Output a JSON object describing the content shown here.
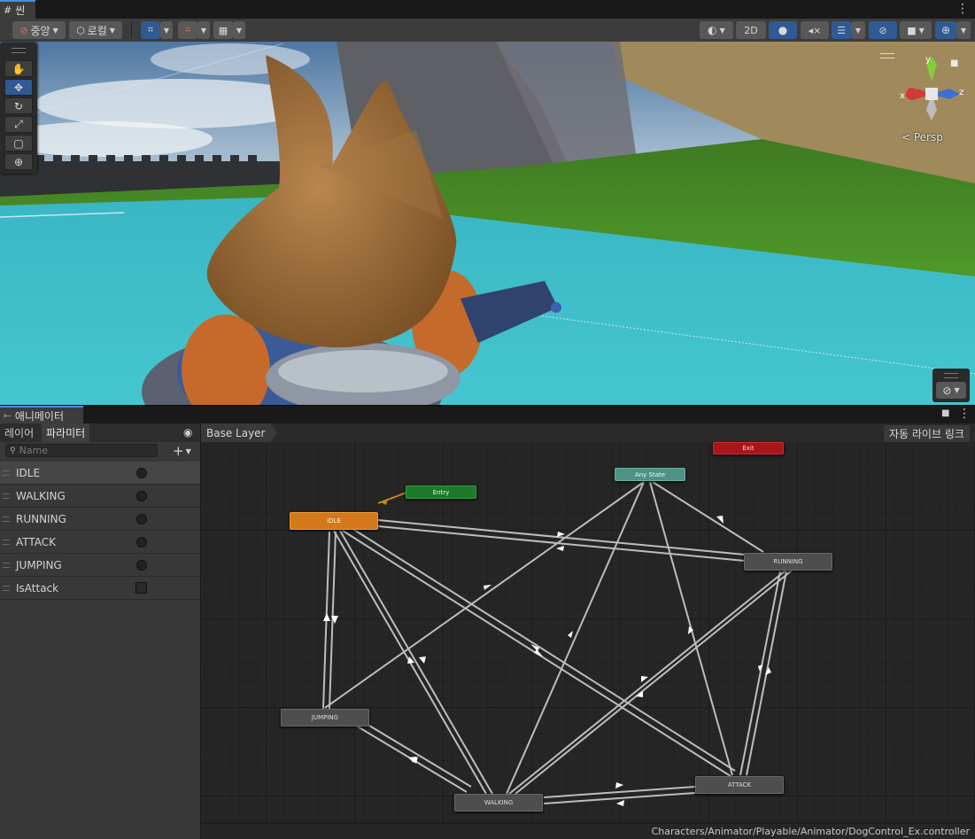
{
  "scene_window": {
    "tab_title": "씬",
    "toolbar": {
      "pivot_label": "중앙",
      "space_label": "로컬",
      "mode_2d_label": "2D"
    },
    "gizmo": {
      "y_label": "y",
      "x_label": "x",
      "z_label": "z",
      "projection_label": "< Persp"
    }
  },
  "animator_window": {
    "tab_title": "애니메이터",
    "left_tabs": [
      "레이어",
      "파라미터"
    ],
    "search_placeholder": "Name",
    "parameters": [
      {
        "name": "IDLE",
        "type": "trigger"
      },
      {
        "name": "WALKING",
        "type": "trigger"
      },
      {
        "name": "RUNNING",
        "type": "trigger"
      },
      {
        "name": "ATTACK",
        "type": "trigger"
      },
      {
        "name": "JUMPING",
        "type": "trigger"
      },
      {
        "name": "IsAttack",
        "type": "bool"
      }
    ],
    "breadcrumb": "Base Layer",
    "live_link_label": "자동 라이브 링크",
    "states": {
      "exit": "Exit",
      "any_state": "Any State",
      "entry": "Entry",
      "idle": "IDLE",
      "running": "RUNNING",
      "jumping": "JUMPING",
      "walking": "WALKING",
      "attack": "ATTACK"
    },
    "asset_path": "Characters/Animator/Playable/Animator/DogControl_Ex.controller"
  },
  "colors": {
    "accent_blue": "#2f5a93",
    "idle_state": "#d3791c",
    "entry_state": "#1e7a2a",
    "any_state": "#4f9185",
    "exit_state": "#a8161a"
  }
}
